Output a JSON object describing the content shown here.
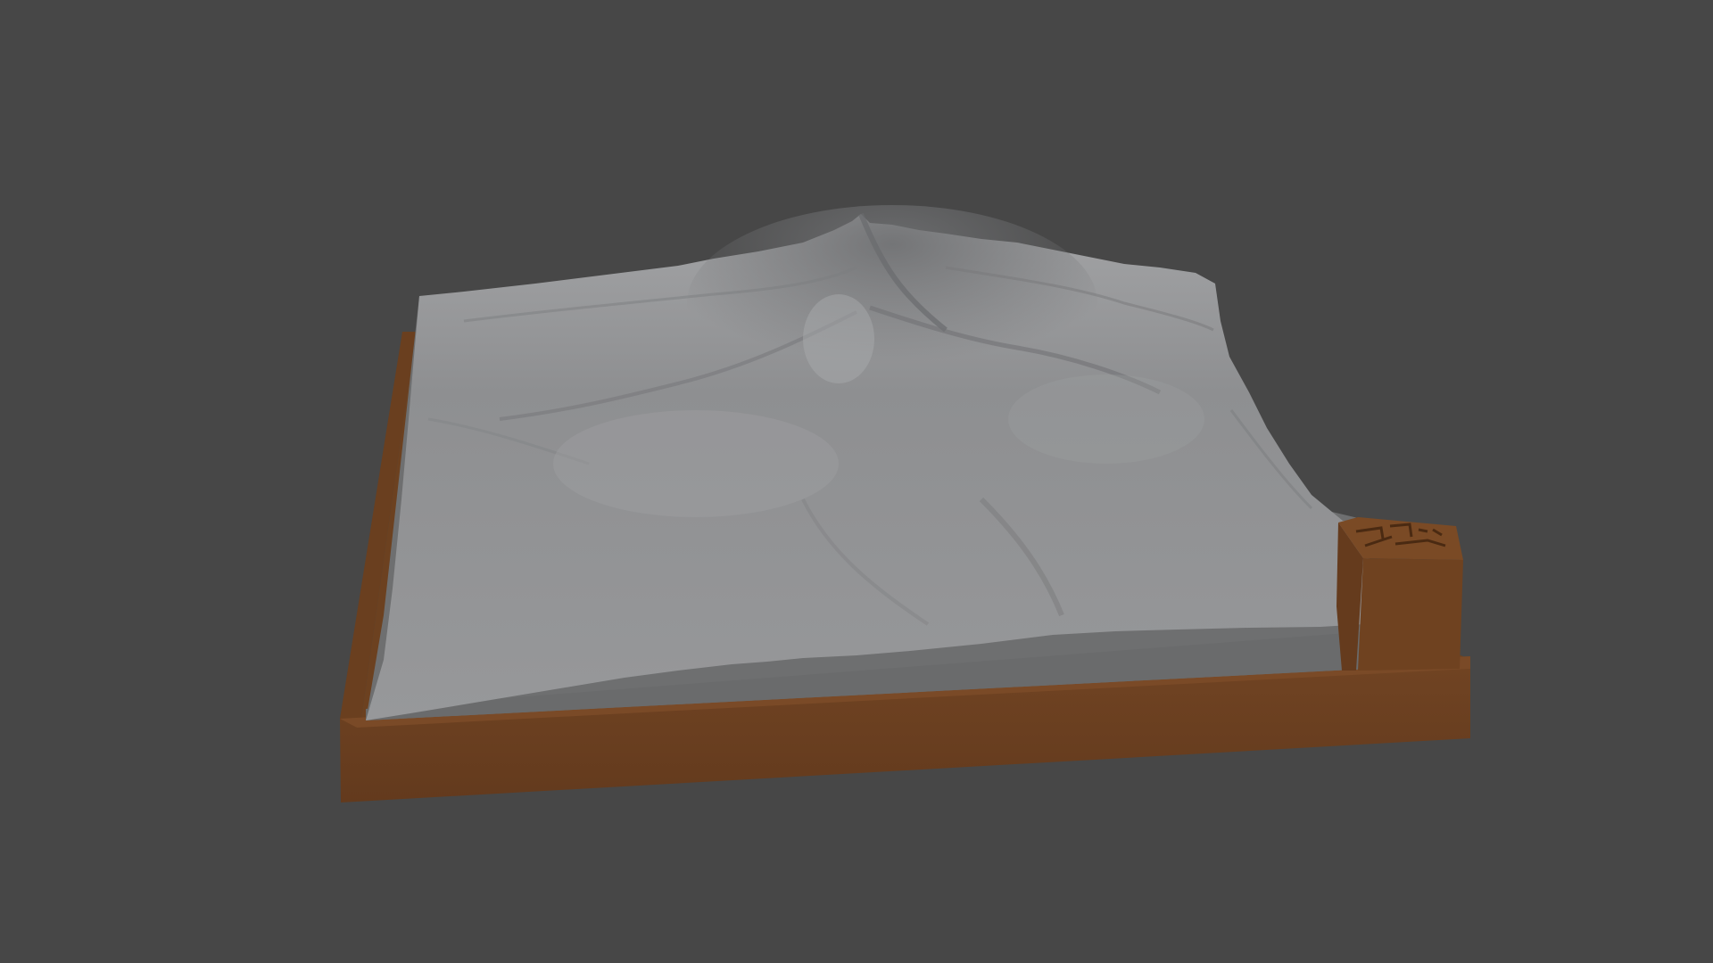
{
  "viewport": {
    "background_color": "#474747"
  },
  "model": {
    "terrain_color": "#8f9091",
    "terrain_side_color": "#6d6e6f",
    "base_color": "#693f1f",
    "base_shadow_color": "#5a3518",
    "label_block_color": "#6f4220"
  }
}
